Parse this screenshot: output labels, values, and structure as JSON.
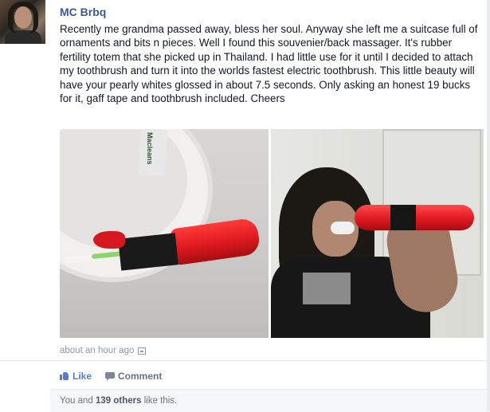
{
  "post": {
    "author": "MC Brbq",
    "text": "Recently me grandma passed away, bless her soul. Anyway she left me a suitcase full of ornaments and bits n pieces. Well I found this souvenier/back massager. It's rubber fertility totem that she picked up in Thailand. I had little use for it until I decided to attach my toothbrush and turn it into the worlds fastest electric toothbrush. This little beauty will have your pearly whites glossed in about 7.5 seconds. Only asking an honest 19 bucks for it, gaff tape and toothbrush included. Cheers",
    "timestamp": "about an hour ago",
    "photo1_tube_label": "Macleans"
  },
  "actions": {
    "like_label": "Like",
    "comment_label": "Comment"
  },
  "likes": {
    "prefix": "You and ",
    "count": "139 others",
    "suffix": " like this."
  },
  "colors": {
    "link": "#3b5998",
    "muted": "#9197a3",
    "like_blue": "#5b7bc0"
  },
  "icons": {
    "timestamp": "photo-icon",
    "like": "thumbs-up-icon",
    "comment": "comment-icon"
  }
}
